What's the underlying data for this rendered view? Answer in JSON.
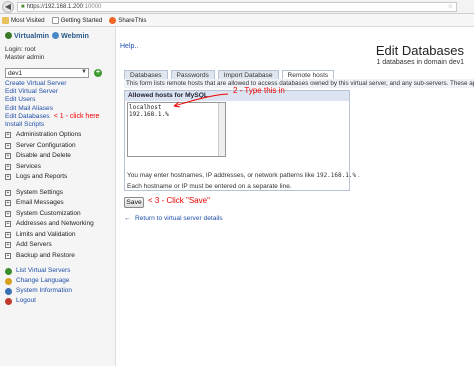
{
  "browser": {
    "url_host": "https://192.168.1.200",
    "url_port": ":10000",
    "bookmarks": [
      {
        "label": "Most Visited",
        "icon": "folder-icon"
      },
      {
        "label": "Getting Started",
        "icon": "page-icon"
      },
      {
        "label": "ShareThis",
        "icon": "sharethis-icon"
      }
    ]
  },
  "sidebar": {
    "brand_left": "Virtualmin",
    "brand_right": "Webmin",
    "login": "Login: root",
    "role": "Master admin",
    "domain_selected": "dev1",
    "links": [
      {
        "label": "Edit Virtual Server",
        "note": ""
      },
      {
        "label": "Edit Users",
        "note": ""
      },
      {
        "label": "Edit Mail Aliases",
        "note": ""
      },
      {
        "label": "Edit Databases",
        "note": "< 1 - click here"
      },
      {
        "label": "Install Scripts",
        "note": ""
      }
    ],
    "first_link": "Create Virtual Server",
    "group1": [
      "Administration Options",
      "Server Configuration",
      "Disable and Delete",
      "Services",
      "Logs and Reports"
    ],
    "group2": [
      "System Settings",
      "Email Messages",
      "System Customization",
      "Addresses and Networking",
      "Limits and Validation",
      "Add Servers",
      "Backup and Restore"
    ],
    "bottom": [
      {
        "label": "List Virtual Servers",
        "icon": "list-servers-icon",
        "color": "#3c8d2c"
      },
      {
        "label": "Change Language",
        "icon": "language-icon",
        "color": "#d8a020"
      },
      {
        "label": "System Information",
        "icon": "info-icon",
        "color": "#3b6fb6"
      },
      {
        "label": "Logout",
        "icon": "logout-icon",
        "color": "#c0392b"
      }
    ]
  },
  "main": {
    "help_link": "Help..",
    "title": "Edit Databases",
    "subtitle": "1 databases in domain dev1",
    "tabs": [
      "Databases",
      "Passwords",
      "Import Database",
      "Remote hosts"
    ],
    "active_tab": 3,
    "description": "This form lists remote hosts that are allowed to access databases owned by this virtual server, and any sub-servers. These apply",
    "box_title": "Allowed hosts for MySQL",
    "hosts_value": "localhost\n192.168.1.%",
    "hint_prefix": "You may enter hostnames, IP addresses, or network patterns like",
    "hint_example": "192.168.1.%",
    "hint2": "Each hostname or IP must be entered on a separate line.",
    "save_label": "Save",
    "return_link": "Return to virtual server details",
    "note_type": "2 - Type this in",
    "note_save": "< 3 - Click \"Save\""
  },
  "colors": {
    "link": "#1f4fa8",
    "annotation": "#e00000",
    "tab_bg": "#dfe6ef"
  }
}
